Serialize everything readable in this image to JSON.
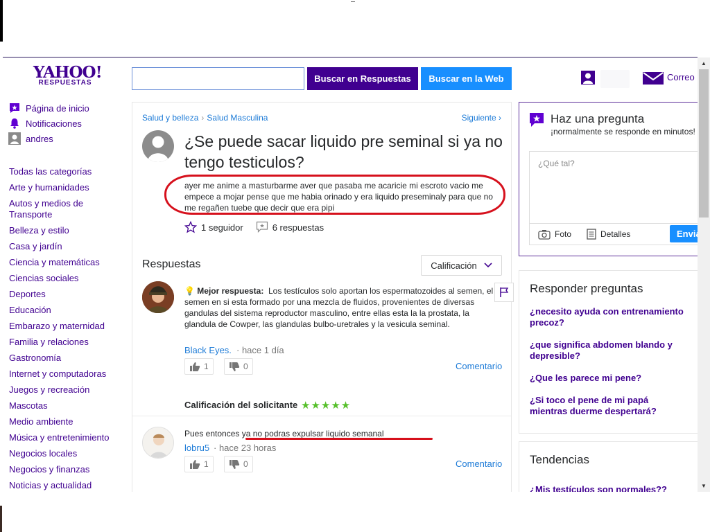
{
  "header": {
    "logo_main": "YAHOO!",
    "logo_sub": "RESPUESTAS",
    "search_placeholder": "",
    "search_answers_btn": "Buscar en Respuestas",
    "search_web_btn": "Buscar en la Web",
    "mail_label": "Correo"
  },
  "nav": {
    "top_items": [
      {
        "label": "Página de inicio",
        "icon": "star-icon"
      },
      {
        "label": "Notificaciones",
        "icon": "bell-icon"
      },
      {
        "label": "andres",
        "icon": "user-icon"
      }
    ],
    "categories": [
      "Todas las categorías",
      "Arte y humanidades",
      "Autos y medios de Transporte",
      "Belleza y estilo",
      "Casa y jardín",
      "Ciencia y matemáticas",
      "Ciencias sociales",
      "Deportes",
      "Educación",
      "Embarazo y maternidad",
      "Familia y relaciones",
      "Gastronomía",
      "Internet y computadoras",
      "Juegos y recreación",
      "Mascotas",
      "Medio ambiente",
      "Música y entretenimiento",
      "Negocios locales",
      "Negocios y finanzas",
      "Noticias y actualidad"
    ]
  },
  "question": {
    "breadcrumb": [
      "Salud y belleza",
      "Salud Masculina"
    ],
    "next_label": "Siguiente",
    "title": "¿Se puede sacar liquido pre seminal si ya no tengo testiculos?",
    "body": "ayer me anime a masturbarme aver que pasaba me acaricie mi escroto vacio me empece a mojar pense que me habia orinado y era liquido preseminaly para que no me regañen tuebe que decir que era pipi",
    "followers": "1 seguidor",
    "answers_count": "6 respuestas"
  },
  "answers_section": {
    "heading": "Respuestas",
    "sort_label": "Calificación"
  },
  "best_answer": {
    "label": "Mejor respuesta:",
    "text": "Los testículos solo aportan los espermatozoides al semen, el semen en si esta formado por una mezcla de fluidos, provenientes de diversas gandulas del sistema reproductor masculino, entre ellas esta la la prostata, la glandula de Cowper, las glandulas bulbo-uretrales y la vesicula seminal.",
    "author": "Black Eyes.",
    "time": "· hace 1 día",
    "upvotes": "1",
    "downvotes": "0",
    "comment_label": "Comentario",
    "rating_label": "Calificación del solicitante",
    "rating_stars": 5,
    "rating_glyphs": "★★★★★"
  },
  "answer2": {
    "text": "Pues entonces ya no podras expulsar liquido semanal",
    "author": "lobru5",
    "time": "· hace 23 horas",
    "upvotes": "1",
    "downvotes": "0",
    "comment_label": "Comentario"
  },
  "ask": {
    "title": "Haz una pregunta",
    "subtitle": "¡normalmente se responde en minutos!",
    "placeholder": "¿Qué tal?",
    "photo_label": "Foto",
    "details_label": "Detalles",
    "send_label": "Enviar"
  },
  "answer_questions": {
    "title": "Responder preguntas",
    "items": [
      "¿necesito ayuda con entrenamiento precoz?",
      "¿que significa abdomen blando y depresible?",
      "¿Que les parece mi pene?",
      "¿Si toco el pene de mi papá mientras duerme despertará?"
    ]
  },
  "trends": {
    "title": "Tendencias",
    "items": [
      "¿Mis testículos son normales??"
    ]
  },
  "colors": {
    "brand_purple": "#400090",
    "link_blue": "#1d7bd7",
    "web_button_blue": "#188fff",
    "annotation_red": "#d6101c",
    "star_green": "#56c02b"
  }
}
